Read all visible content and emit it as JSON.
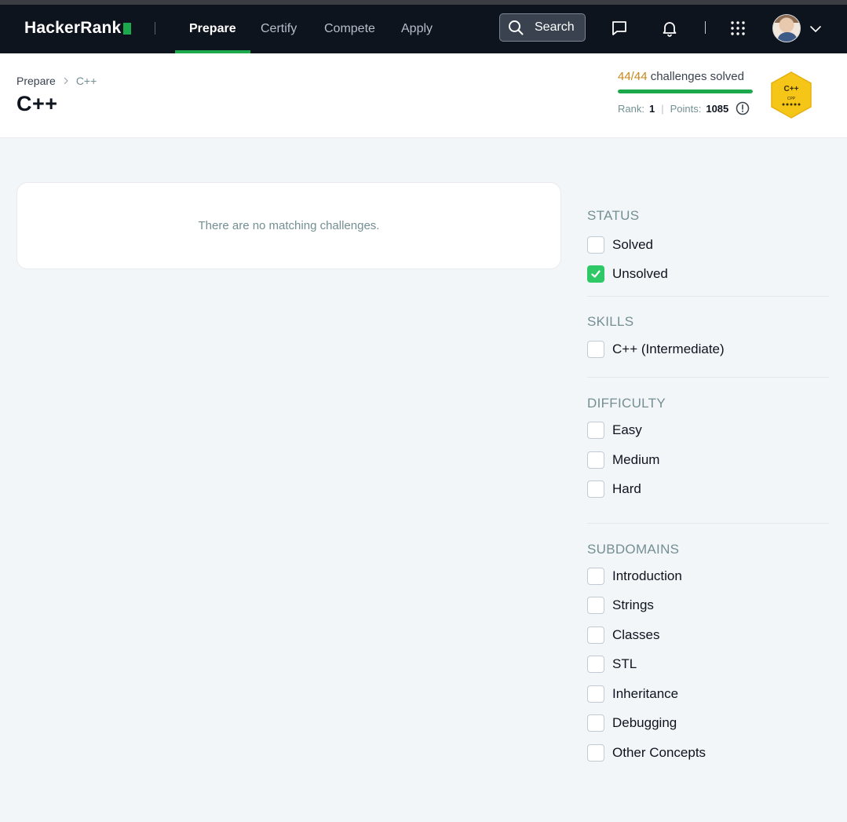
{
  "nav": {
    "logo": "HackerRank",
    "links": [
      {
        "label": "Prepare",
        "active": true
      },
      {
        "label": "Certify",
        "active": false
      },
      {
        "label": "Compete",
        "active": false
      },
      {
        "label": "Apply",
        "active": false
      }
    ],
    "search_label": "Search",
    "icons": [
      "search-icon",
      "messages-icon",
      "notification-bell-icon",
      "apps-grid-icon",
      "chevron-down-icon"
    ]
  },
  "header": {
    "breadcrumb": [
      "Prepare",
      "C++"
    ],
    "title": "C++",
    "solved_count": "44/44",
    "solved_text": "challenges solved",
    "progress_fraction": 1.0,
    "rank_label": "Rank:",
    "rank_value": "1",
    "points_label": "Points:",
    "points_value": "1085",
    "badge": {
      "title": "C++",
      "subtitle": "CPP",
      "stars": 5,
      "color": "#f5c518"
    }
  },
  "main": {
    "empty_message": "There are no matching challenges."
  },
  "filters": {
    "status": {
      "title": "STATUS",
      "options": [
        {
          "label": "Solved",
          "checked": false
        },
        {
          "label": "Unsolved",
          "checked": true
        }
      ]
    },
    "skills": {
      "title": "SKILLS",
      "options": [
        {
          "label": "C++ (Intermediate)",
          "checked": false
        }
      ]
    },
    "difficulty": {
      "title": "DIFFICULTY",
      "options": [
        {
          "label": "Easy",
          "checked": false
        },
        {
          "label": "Medium",
          "checked": false
        },
        {
          "label": "Hard",
          "checked": false
        }
      ]
    },
    "subdomains": {
      "title": "SUBDOMAINS",
      "options": [
        {
          "label": "Introduction",
          "checked": false
        },
        {
          "label": "Strings",
          "checked": false
        },
        {
          "label": "Classes",
          "checked": false
        },
        {
          "label": "STL",
          "checked": false
        },
        {
          "label": "Inheritance",
          "checked": false
        },
        {
          "label": "Debugging",
          "checked": false
        },
        {
          "label": "Other Concepts",
          "checked": false
        }
      ]
    }
  },
  "colors": {
    "nav_bg": "#0e141e",
    "accent_green": "#1ba94c",
    "checkbox_green": "#2ec866",
    "solved_orange": "#c7861c"
  }
}
